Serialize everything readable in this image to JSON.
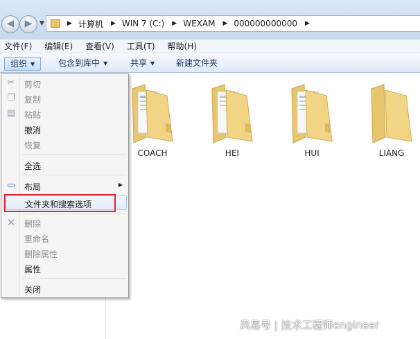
{
  "address": {
    "crumbs": [
      "计算机",
      "WIN 7 (C:)",
      "WEXAM",
      "000000000000"
    ]
  },
  "menubar": {
    "items": [
      "文件(F)",
      "编辑(E)",
      "查看(V)",
      "工具(T)",
      "帮助(H)"
    ]
  },
  "toolbar": {
    "organize": "组织",
    "include_library": "包含到库中",
    "share": "共享",
    "new_folder": "新建文件夹"
  },
  "folders": [
    "COACH",
    "HEI",
    "HUI",
    "LIANG"
  ],
  "organize_menu": {
    "cut": "剪切",
    "copy": "复制",
    "paste": "粘贴",
    "undo": "撤消",
    "redo": "恢复",
    "select_all": "全选",
    "layout": "布局",
    "folder_options": "文件夹和搜索选项",
    "delete": "删除",
    "rename": "重命名",
    "remove_properties": "删除属性",
    "properties": "属性",
    "close": "关闭"
  },
  "icons": {
    "back": "back-arrow-icon",
    "forward": "forward-arrow-icon",
    "layout": "layout-pane-icon",
    "delete": "delete-x-icon"
  },
  "watermark": "风易号 | 技术工程师engineer",
  "colors": {
    "highlight_box": "#e0242a",
    "folder_yellow": "#efcf7c"
  }
}
